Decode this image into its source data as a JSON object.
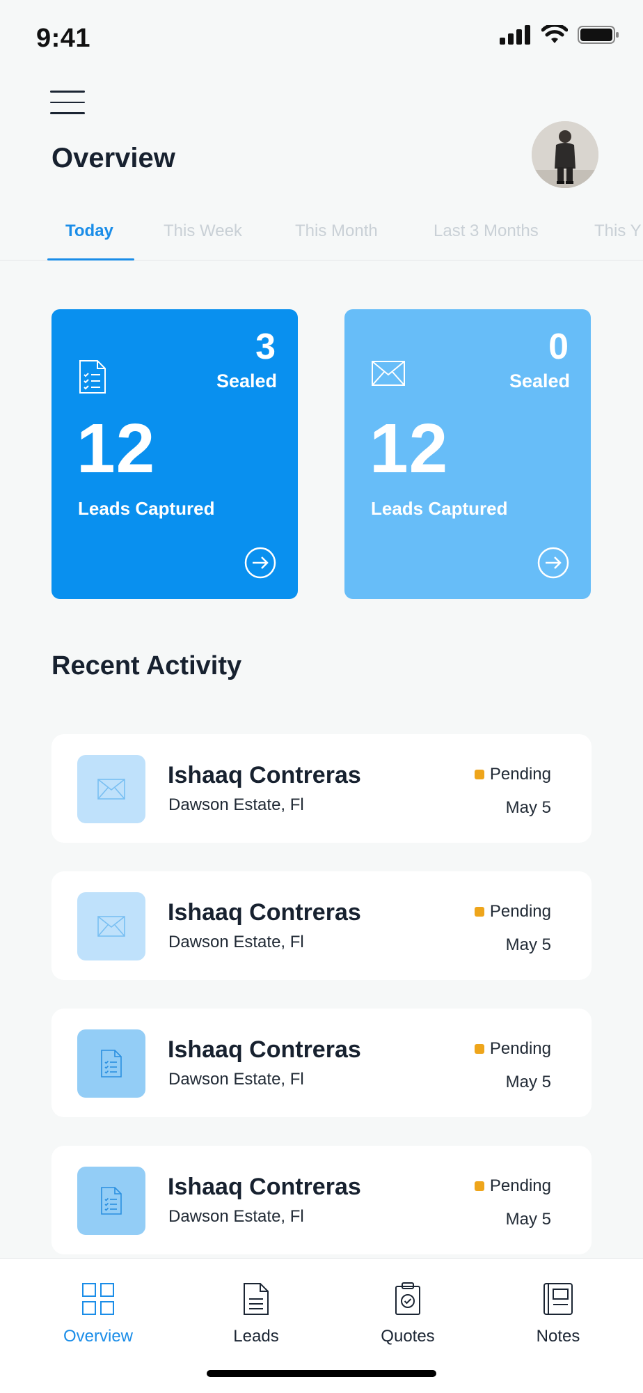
{
  "status_bar": {
    "time": "9:41"
  },
  "header": {
    "title": "Overview"
  },
  "tabs": [
    {
      "label": "Today",
      "active": true
    },
    {
      "label": "This Week",
      "active": false
    },
    {
      "label": "This Month",
      "active": false
    },
    {
      "label": "Last 3 Months",
      "active": false
    },
    {
      "label": "This Y",
      "active": false
    }
  ],
  "cards": [
    {
      "icon": "document-checklist-icon",
      "sealed_count": "3",
      "sealed_label": "Sealed",
      "leads_count": "12",
      "leads_label": "Leads Captured",
      "color": "#0990ef"
    },
    {
      "icon": "envelope-icon",
      "sealed_count": "0",
      "sealed_label": "Sealed",
      "leads_count": "12",
      "leads_label": "Leads Captured",
      "color": "#67bdf8"
    }
  ],
  "recent_activity": {
    "title": "Recent Activity",
    "items": [
      {
        "icon": "envelope-icon",
        "name": "Ishaaq Contreras",
        "location": "Dawson Estate, Fl",
        "status": "Pending",
        "date": "May 5"
      },
      {
        "icon": "envelope-icon",
        "name": "Ishaaq Contreras",
        "location": "Dawson Estate, Fl",
        "status": "Pending",
        "date": "May 5"
      },
      {
        "icon": "document-icon",
        "name": "Ishaaq Contreras",
        "location": "Dawson Estate, Fl",
        "status": "Pending",
        "date": "May 5"
      },
      {
        "icon": "document-icon",
        "name": "Ishaaq Contreras",
        "location": "Dawson Estate, Fl",
        "status": "Pending",
        "date": "May 5"
      }
    ]
  },
  "bottom_nav": [
    {
      "label": "Overview",
      "icon": "grid-icon",
      "active": true
    },
    {
      "label": "Leads",
      "icon": "document-icon",
      "active": false
    },
    {
      "label": "Quotes",
      "icon": "clipboard-check-icon",
      "active": false
    },
    {
      "label": "Notes",
      "icon": "notebook-icon",
      "active": false
    }
  ],
  "colors": {
    "accent": "#1a8de8",
    "pending": "#eea51b"
  }
}
